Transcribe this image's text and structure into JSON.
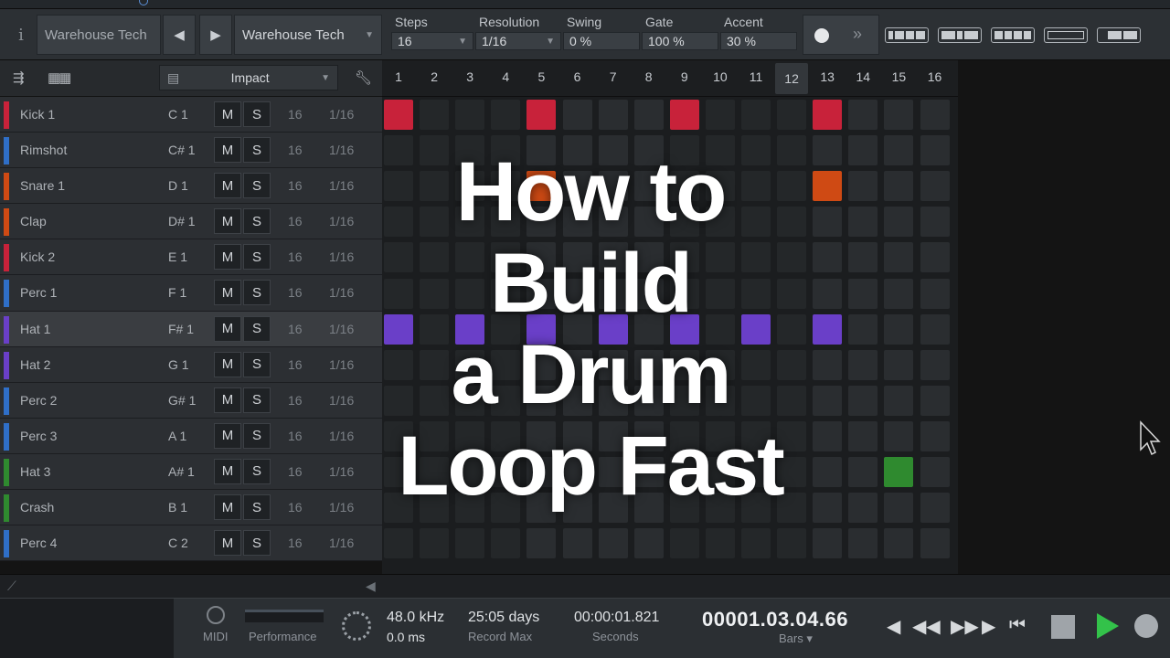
{
  "toolbar": {
    "info_icon": "i",
    "preset_left": "Warehouse Tech",
    "prev_icon": "◀",
    "next_icon": "▶",
    "preset_main": "Warehouse Tech",
    "params": [
      {
        "label": "Steps",
        "value": "16"
      },
      {
        "label": "Resolution",
        "value": "1/16"
      },
      {
        "label": "Swing",
        "value": "0 %"
      },
      {
        "label": "Gate",
        "value": "100 %"
      },
      {
        "label": "Accent",
        "value": "30 %"
      }
    ]
  },
  "kit": {
    "name": "Impact"
  },
  "columns": [
    "1",
    "2",
    "3",
    "4",
    "5",
    "6",
    "7",
    "8",
    "9",
    "10",
    "11",
    "12",
    "13",
    "14",
    "15",
    "16"
  ],
  "highlight_column": 12,
  "buttons": {
    "mute": "M",
    "solo": "S"
  },
  "tracks": [
    {
      "name": "Kick 1",
      "note": "C 1",
      "steps": "16",
      "res": "1/16",
      "color": "#c8223a"
    },
    {
      "name": "Rimshot",
      "note": "C# 1",
      "steps": "16",
      "res": "1/16",
      "color": "#2f6fc8"
    },
    {
      "name": "Snare 1",
      "note": "D 1",
      "steps": "16",
      "res": "1/16",
      "color": "#cf4a14"
    },
    {
      "name": "Clap",
      "note": "D# 1",
      "steps": "16",
      "res": "1/16",
      "color": "#cf4a14"
    },
    {
      "name": "Kick 2",
      "note": "E 1",
      "steps": "16",
      "res": "1/16",
      "color": "#c8223a"
    },
    {
      "name": "Perc 1",
      "note": "F 1",
      "steps": "16",
      "res": "1/16",
      "color": "#2f6fc8"
    },
    {
      "name": "Hat 1",
      "note": "F# 1",
      "steps": "16",
      "res": "1/16",
      "color": "#6a3fc8"
    },
    {
      "name": "Hat 2",
      "note": "G 1",
      "steps": "16",
      "res": "1/16",
      "color": "#6a3fc8"
    },
    {
      "name": "Perc 2",
      "note": "G# 1",
      "steps": "16",
      "res": "1/16",
      "color": "#2f6fc8"
    },
    {
      "name": "Perc 3",
      "note": "A 1",
      "steps": "16",
      "res": "1/16",
      "color": "#2f6fc8"
    },
    {
      "name": "Hat 3",
      "note": "A# 1",
      "steps": "16",
      "res": "1/16",
      "color": "#2f8a2f"
    },
    {
      "name": "Crash",
      "note": "B 1",
      "steps": "16",
      "res": "1/16",
      "color": "#2f8a2f"
    },
    {
      "name": "Perc 4",
      "note": "C 2",
      "steps": "16",
      "res": "1/16",
      "color": "#2f6fc8"
    }
  ],
  "selected_track": 6,
  "active_steps": [
    {
      "row": 0,
      "steps": [
        1,
        5,
        9,
        13
      ],
      "color": "#c8223a"
    },
    {
      "row": 2,
      "steps": [
        5,
        13
      ],
      "color": "#cf4a14"
    },
    {
      "row": 6,
      "steps": [
        1,
        3,
        5,
        7,
        9,
        11,
        13
      ],
      "color": "#6a3fc8"
    },
    {
      "row": 10,
      "steps": [
        15
      ],
      "color": "#2f8a2f"
    }
  ],
  "status": {
    "midi": "MIDI",
    "performance": "Performance",
    "sample_rate": "48.0 kHz",
    "latency": "0.0 ms",
    "record_max_value": "25:05 days",
    "record_max_label": "Record Max",
    "seconds_value": "00:00:01.821",
    "seconds_label": "Seconds",
    "timecode": "00001.03.04.66",
    "bars_label": "Bars ▾"
  },
  "overlay": {
    "lines": [
      "How to",
      "Build",
      "a Drum",
      "Loop Fast"
    ]
  }
}
